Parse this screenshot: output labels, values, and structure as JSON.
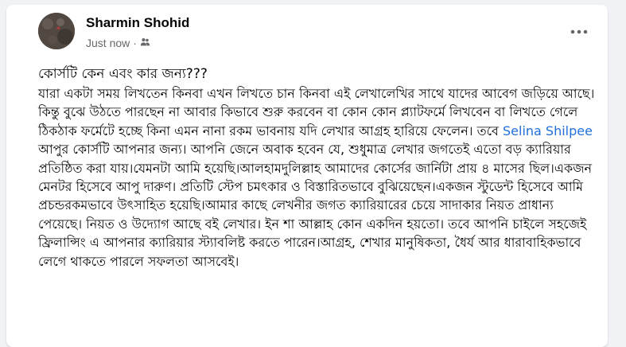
{
  "post": {
    "author": "Sharmin Shohid",
    "timestamp": "Just now",
    "separator": "·",
    "audience_icon": "friends-icon",
    "title": "কোর্সটি কেন এবং কার জন্য???",
    "body_part1": "যারা একটা সময় লিখতেন কিনবা এখন লিখতে চান কিনবা এই লেখালেখির সাথে  যাদের আবেগ জড়িয়ে আছে।কিন্তু বুঝে উঠতে পারছেন না আবার কিভাবে শুরু করবেন বা কোন কোন প্ল্যাটফর্মে লিখবেন বা লিখতে গেলে ঠিকঠাক ফর্মেটে হচ্ছে কিনা এমন নানা রকম ভাবনায় যদি লেখার আগ্রহ হারিয়ে ফেলেন। তবে ",
    "mention": "Selina Shilpee",
    "body_part2": "  আপুর কোর্সটি আপনার জন্য। আপনি জেনে অবাক হবেন যে, শুধুমাত্র লেখার জগতেই এতো বড় ক্যারিয়ার প্রতিষ্ঠিত করা যায়।যেমনটা আমি হয়েছি।আলহামদুলিল্লাহ আমাদের কোর্সের জার্নিটা প্রায় ৪ মাসের ছিল।একজন মেনটর হিসেবে আপু দারুণ। প্রতিটি স্টেপ চমৎকার ও বিস্তারিতভাবে বুঝিয়েছেন।একজন স্টুডেন্ট হিসেবে আমি প্রচন্ডরকমভাবে উৎসাহিত হয়েছি।আমার কাছে লেখনীর জগত ক্যারিয়ারের চেয়ে সাদাকার নিয়ত প্রাধান্য পেয়েছে। নিয়ত ও উদ্যোগ আছে বই লেখার। ইন শা আল্লাহ কোন একদিন হয়তো। তবে আপনি চাইলে সহজেই ফ্রিলান্সিং এ আপনার ক্যারিয়ার স্ট্যাবলিষ্ট করতে পারেন।আগ্রহ, শেখার মানুষিকতা, ধৈর্য আর ধারাবাহিকভাবে লেগে থাকতে পারলে সফলতা আসবেই।",
    "more_options_icon": "more-horizontal-icon",
    "colors": {
      "background": "#f0f2f5",
      "card": "#ffffff",
      "text": "#050505",
      "secondary_text": "#65676b",
      "link": "#216fdb"
    }
  }
}
